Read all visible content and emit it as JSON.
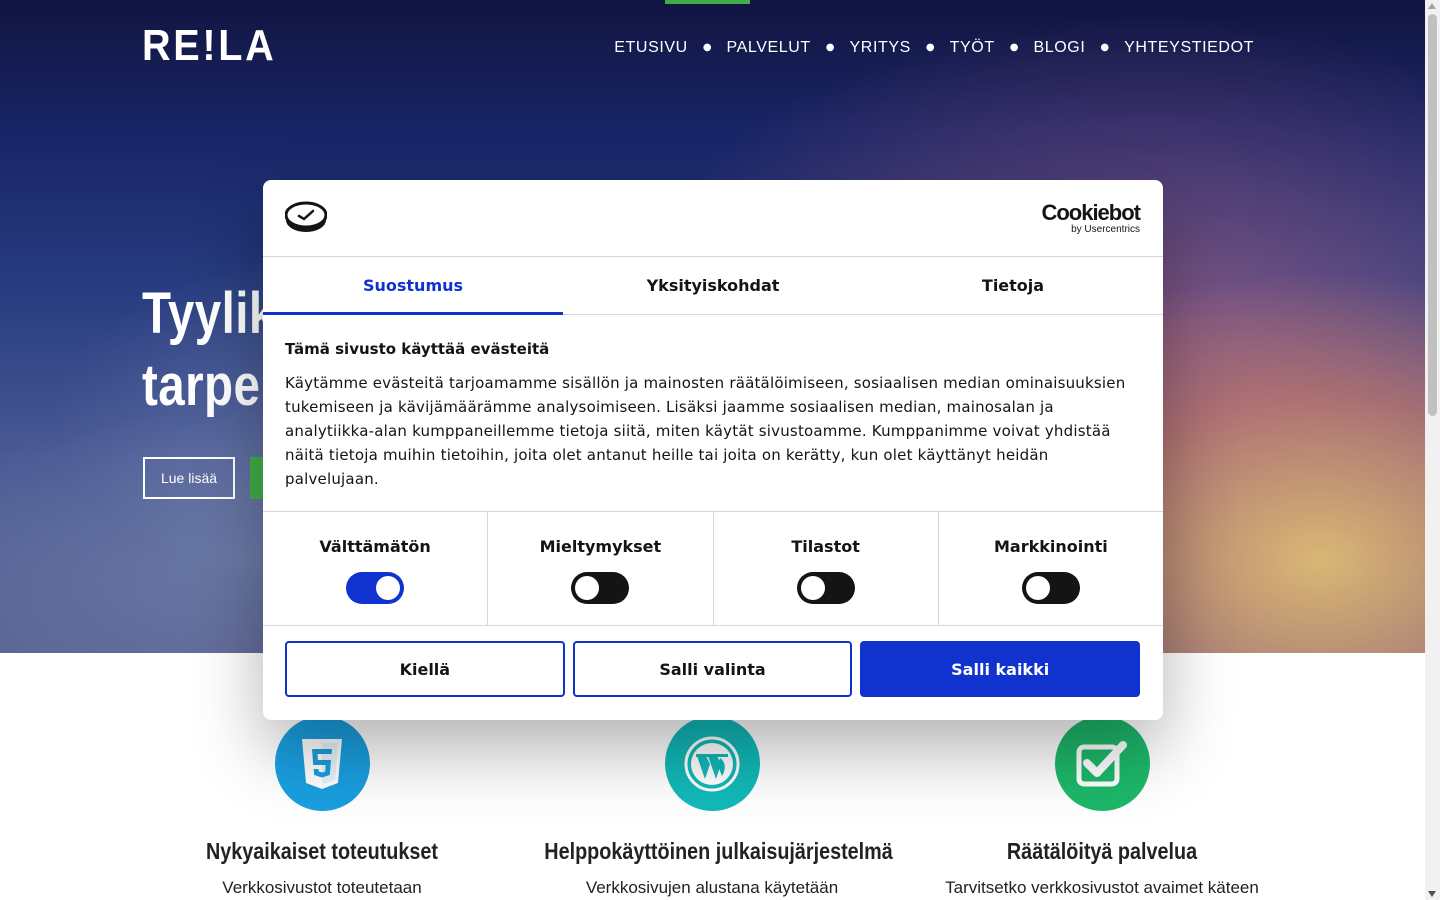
{
  "site": {
    "logo": "RE!LA",
    "nav": [
      {
        "label": "ETUSIVU"
      },
      {
        "label": "PALVELUT"
      },
      {
        "label": "YRITYS"
      },
      {
        "label": "TYÖT"
      },
      {
        "label": "BLOGI"
      },
      {
        "label": "YHTEYSTIEDOT"
      }
    ],
    "hero": {
      "title_line1": "Tyylik",
      "title_line2": "tarpe",
      "read_more": "Lue lisää"
    },
    "features": [
      {
        "icon": "html5-icon",
        "title": "Nykyaikaiset toteutukset",
        "text": "Verkkosivustot toteutetaan",
        "color": "#1a9fe0"
      },
      {
        "icon": "wordpress-icon",
        "title": "Helppokäyttöinen julkaisujärjestelmä",
        "text": "Verkkosivujen alustana käytetään",
        "color": "#12b9b9"
      },
      {
        "icon": "checkbox-icon",
        "title": "Räätälöityä palvelua",
        "text": "Tarvitsetko verkkosivustot avaimet käteen",
        "color": "#1db86a"
      }
    ]
  },
  "cookie_dialog": {
    "brand": {
      "name": "Cookiebot",
      "sub": "by Usercentrics"
    },
    "tabs": [
      {
        "label": "Suostumus",
        "active": true
      },
      {
        "label": "Yksityiskohdat",
        "active": false
      },
      {
        "label": "Tietoja",
        "active": false
      }
    ],
    "heading": "Tämä sivusto käyttää evästeitä",
    "body": "Käytämme evästeitä tarjoamamme sisällön ja mainosten räätälöimiseen, sosiaalisen median ominaisuuksien tukemiseen ja kävijämäärämme analysoimiseen. Lisäksi jaamme sosiaalisen median, mainosalan ja analytiikka-alan kumppaneillemme tietoja siitä, miten käytät sivustoamme. Kumppanimme voivat yhdistää näitä tietoja muihin tietoihin, joita olet antanut heille tai joita on kerätty, kun olet käyttänyt heidän palvelujaan.",
    "toggles": [
      {
        "label": "Välttämätön",
        "on": true
      },
      {
        "label": "Mieltymykset",
        "on": false
      },
      {
        "label": "Tilastot",
        "on": false
      },
      {
        "label": "Markkinointi",
        "on": false
      }
    ],
    "buttons": {
      "deny": "Kiellä",
      "allow_selection": "Salli valinta",
      "allow_all": "Salli kaikki"
    }
  },
  "colors": {
    "accent": "#1032cf",
    "green": "#3fae49"
  }
}
